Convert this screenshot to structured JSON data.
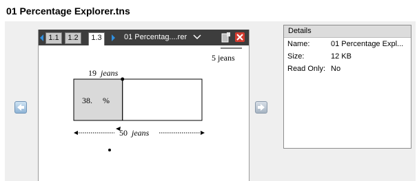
{
  "window": {
    "title": "01 Percentage Explorer.tns"
  },
  "device": {
    "tabs": [
      "1.1",
      "1.2",
      "1.3"
    ],
    "active_tab": "1.3",
    "doc_label": "01 Percentag....rer"
  },
  "canvas": {
    "scale_label": "5 jeans",
    "top_label_number": "19",
    "top_label_unit": "jeans",
    "percent_number": "38.",
    "percent_sign": "%",
    "bottom_label_number": "50",
    "bottom_label_unit": "jeans",
    "shaded_fraction": 0.38
  },
  "details": {
    "heading": "Details",
    "rows": [
      {
        "label": "Name:",
        "value": "01 Percentage Expl..."
      },
      {
        "label": "Size:",
        "value": "12 KB"
      },
      {
        "label": "Read Only:",
        "value": "No"
      }
    ]
  },
  "colors": {
    "shaded": "#d9d9d9",
    "tabbar": "#3d3d3d",
    "close": "#d23a2e",
    "tab_arrow": "#2f8fe0"
  }
}
